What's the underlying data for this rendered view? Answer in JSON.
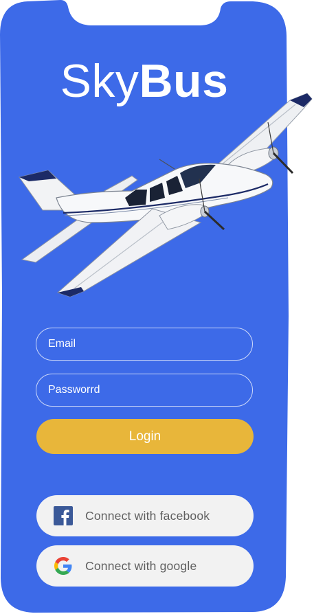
{
  "app": {
    "logo_light": "Sky",
    "logo_bold": "Bus"
  },
  "login_form": {
    "email_placeholder": "Email",
    "password_placeholder": "Passworrd",
    "login_label": "Login"
  },
  "social": {
    "facebook_label": "Connect with facebook",
    "google_label": "Connect with google",
    "facebook_icon": "facebook-icon",
    "google_icon": "google-icon"
  },
  "colors": {
    "background": "#3d6ae8",
    "login_button": "#e8b63a",
    "social_button": "#f2f2f2",
    "facebook_brand": "#3b5998"
  }
}
